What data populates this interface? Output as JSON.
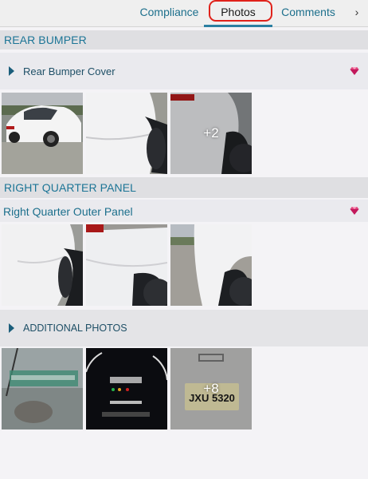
{
  "tabs": {
    "compliance": "Compliance",
    "photos": "Photos",
    "comments": "Comments",
    "more": "›"
  },
  "sections": [
    {
      "title": "REAR BUMPER",
      "sub_label": "Rear Bumper Cover",
      "more_count": "+2"
    },
    {
      "title": "RIGHT QUARTER PANEL",
      "sub_label": "Right Quarter Outer Panel"
    }
  ],
  "additional": {
    "label": "ADDITIONAL PHOTOS",
    "more_count": "+8",
    "plate_text": "JXU 5320"
  },
  "colors": {
    "accent": "#1c7596",
    "tab_underline": "#2b7fa1",
    "highlight": "#e0221b",
    "gem": "#c2185b"
  },
  "icons": {
    "expand": "triangle-right",
    "damage": "gem",
    "more_tabs": "chevron-right"
  }
}
